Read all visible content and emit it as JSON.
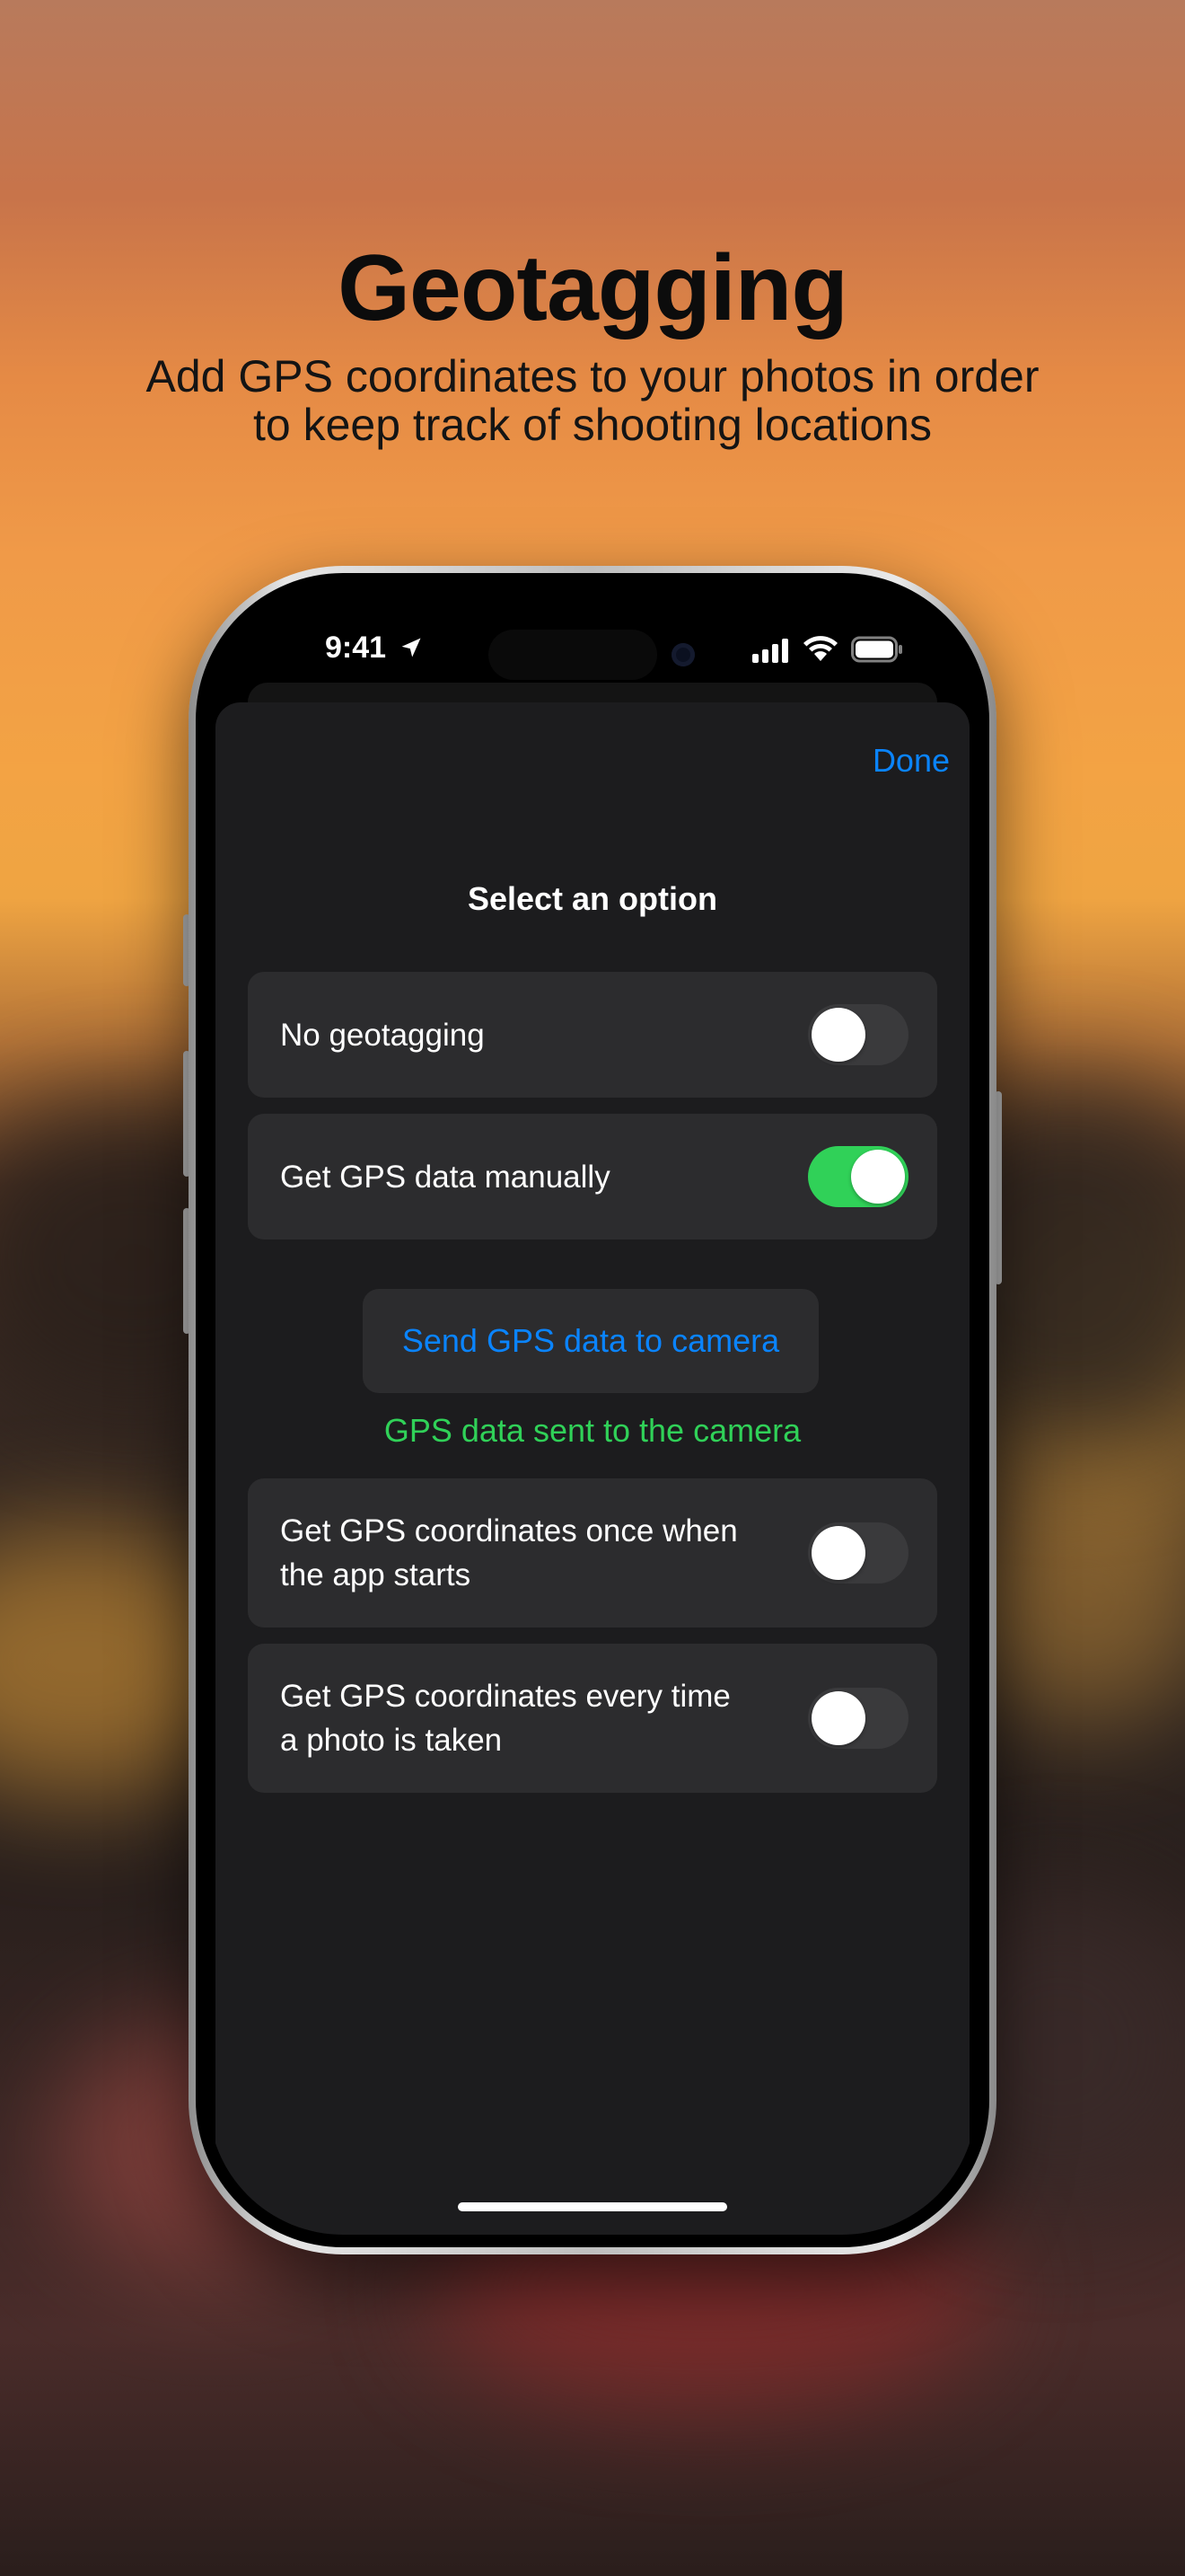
{
  "promo": {
    "title": "Geotagging",
    "subtitle_line1": "Add GPS coordinates to your photos in order",
    "subtitle_line2": "to keep track of shooting locations"
  },
  "status_bar": {
    "time": "9:41",
    "icons": [
      "location-arrow-icon",
      "cellular-signal-icon",
      "wifi-icon",
      "battery-icon"
    ]
  },
  "sheet": {
    "done_label": "Done",
    "title": "Select an option",
    "options": [
      {
        "label_line1": "No geotagging",
        "label_line2": "",
        "enabled": false
      },
      {
        "label_line1": "Get GPS data manually",
        "label_line2": "",
        "enabled": true
      },
      {
        "label_line1": "Get GPS coordinates once when",
        "label_line2": "the app starts",
        "enabled": false
      },
      {
        "label_line1": "Get GPS coordinates every time",
        "label_line2": "a photo is taken",
        "enabled": false
      }
    ],
    "send_button_label": "Send GPS data to camera",
    "send_status": "GPS data sent to the camera"
  },
  "colors": {
    "accent": "#0a84ff",
    "success": "#30d158",
    "sheet_background": "#1c1c1e",
    "row_background": "#2c2c2e"
  }
}
